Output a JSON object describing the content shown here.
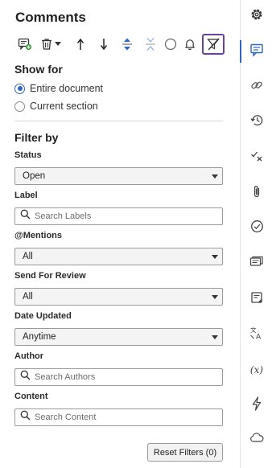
{
  "panel": {
    "title": "Comments"
  },
  "toolbar": {
    "buttons": [
      {
        "icon": "add-comment-icon"
      },
      {
        "icon": "delete-icon"
      },
      {
        "icon": "arrow-up-icon"
      },
      {
        "icon": "arrow-down-icon"
      },
      {
        "icon": "expand-icon"
      },
      {
        "icon": "collapse-icon"
      },
      {
        "icon": "circle-icon"
      },
      {
        "icon": "bell-icon"
      },
      {
        "icon": "filter-off-icon",
        "active": true
      }
    ]
  },
  "show_for": {
    "title": "Show for",
    "options": [
      "Entire document",
      "Current section"
    ],
    "selected": "Entire document"
  },
  "filter": {
    "title": "Filter by",
    "status": {
      "label": "Status",
      "value": "Open"
    },
    "label": {
      "label": "Label",
      "placeholder": "Search Labels"
    },
    "mentions": {
      "label": "@Mentions",
      "value": "All"
    },
    "review": {
      "label": "Send For Review",
      "value": "All"
    },
    "date": {
      "label": "Date Updated",
      "value": "Anytime"
    },
    "author": {
      "label": "Author",
      "placeholder": "Search Authors"
    },
    "content": {
      "label": "Content",
      "placeholder": "Search Content"
    },
    "reset_label": "Reset Filters (0)"
  },
  "rail": {
    "items": [
      {
        "icon": "gear-icon"
      },
      {
        "icon": "comment-icon",
        "active": true
      },
      {
        "icon": "link-icon"
      },
      {
        "icon": "history-icon"
      },
      {
        "icon": "check-x-icon"
      },
      {
        "icon": "attachment-icon"
      },
      {
        "icon": "check-circle-icon"
      },
      {
        "icon": "cards-icon"
      },
      {
        "icon": "note-icon"
      },
      {
        "icon": "translate-icon"
      },
      {
        "icon": "variable-icon",
        "text": "(x)"
      },
      {
        "icon": "lightning-icon"
      },
      {
        "icon": "cloud-icon"
      }
    ]
  },
  "colors": {
    "accent": "#2d64c8",
    "active_outline": "#6b3fa0",
    "add_comment_green": "#3a9a3a"
  }
}
